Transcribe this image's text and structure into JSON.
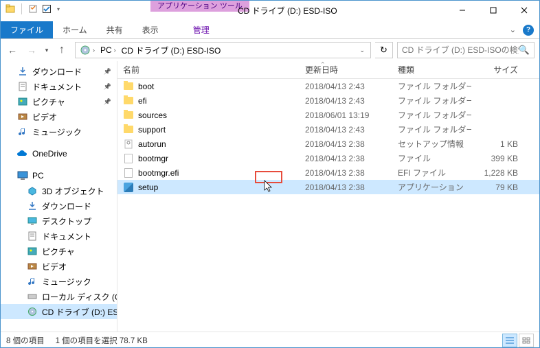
{
  "window": {
    "context_tab": "アプリケーション ツール",
    "title": "CD ドライブ (D:) ESD-ISO"
  },
  "ribbon": {
    "file": "ファイル",
    "home": "ホーム",
    "share": "共有",
    "view": "表示",
    "manage": "管理"
  },
  "address": {
    "segments": [
      "PC",
      "CD ドライブ (D:) ESD-ISO"
    ]
  },
  "search": {
    "placeholder": "CD ドライブ (D:) ESD-ISOの検索"
  },
  "tree": {
    "quick": [
      "ダウンロード",
      "ドキュメント",
      "ピクチャ",
      "ビデオ",
      "ミュージック"
    ],
    "onedrive": "OneDrive",
    "pc_label": "PC",
    "pc": [
      "3D オブジェクト",
      "ダウンロード",
      "デスクトップ",
      "ドキュメント",
      "ピクチャ",
      "ビデオ",
      "ミュージック",
      "ローカル ディスク (C",
      "CD ドライブ (D:) ES"
    ]
  },
  "columns": {
    "name": "名前",
    "date": "更新日時",
    "type": "種類",
    "size": "サイズ"
  },
  "files": [
    {
      "name": "boot",
      "date": "2018/04/13 2:43",
      "type": "ファイル フォルダー",
      "size": "",
      "kind": "folder"
    },
    {
      "name": "efi",
      "date": "2018/04/13 2:43",
      "type": "ファイル フォルダー",
      "size": "",
      "kind": "folder"
    },
    {
      "name": "sources",
      "date": "2018/06/01 13:19",
      "type": "ファイル フォルダー",
      "size": "",
      "kind": "folder"
    },
    {
      "name": "support",
      "date": "2018/04/13 2:43",
      "type": "ファイル フォルダー",
      "size": "",
      "kind": "folder"
    },
    {
      "name": "autorun",
      "date": "2018/04/13 2:38",
      "type": "セットアップ情報",
      "size": "1 KB",
      "kind": "inf"
    },
    {
      "name": "bootmgr",
      "date": "2018/04/13 2:38",
      "type": "ファイル",
      "size": "399 KB",
      "kind": "file"
    },
    {
      "name": "bootmgr.efi",
      "date": "2018/04/13 2:38",
      "type": "EFI ファイル",
      "size": "1,228 KB",
      "kind": "file"
    },
    {
      "name": "setup",
      "date": "2018/04/13 2:38",
      "type": "アプリケーション",
      "size": "79 KB",
      "kind": "exe",
      "selected": true
    }
  ],
  "status": {
    "count": "8 個の項目",
    "selection": "1 個の項目を選択 78.7 KB"
  }
}
